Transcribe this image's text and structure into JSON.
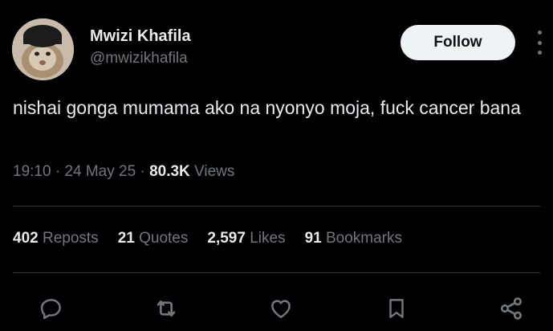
{
  "author": {
    "display_name": "Mwizi Khafila",
    "handle": "@mwizikhafila",
    "avatar_icon": "avatar-cat-photo"
  },
  "follow_label": "Follow",
  "more_icon": "more-vertical-icon",
  "tweet": {
    "text": "nishai gonga mumama ako na nyonyo moja, fuck cancer bana"
  },
  "meta": {
    "time": "19:10",
    "date": "24 May 25",
    "separator": "·",
    "views_count": "80.3K",
    "views_label": "Views"
  },
  "stats": {
    "reposts_count": "402",
    "reposts_label": "Reposts",
    "quotes_count": "21",
    "quotes_label": "Quotes",
    "likes_count": "2,597",
    "likes_label": "Likes",
    "bookmarks_count": "91",
    "bookmarks_label": "Bookmarks"
  },
  "actions": [
    "reply-icon",
    "repost-icon",
    "like-icon",
    "bookmark-icon",
    "share-icon"
  ],
  "colors": {
    "background": "#000000",
    "primary_text": "#e7e9ea",
    "secondary_text": "#71767b",
    "divider": "#2f3336",
    "follow_button_bg": "#eff3f4",
    "follow_button_text": "#0f1419"
  }
}
